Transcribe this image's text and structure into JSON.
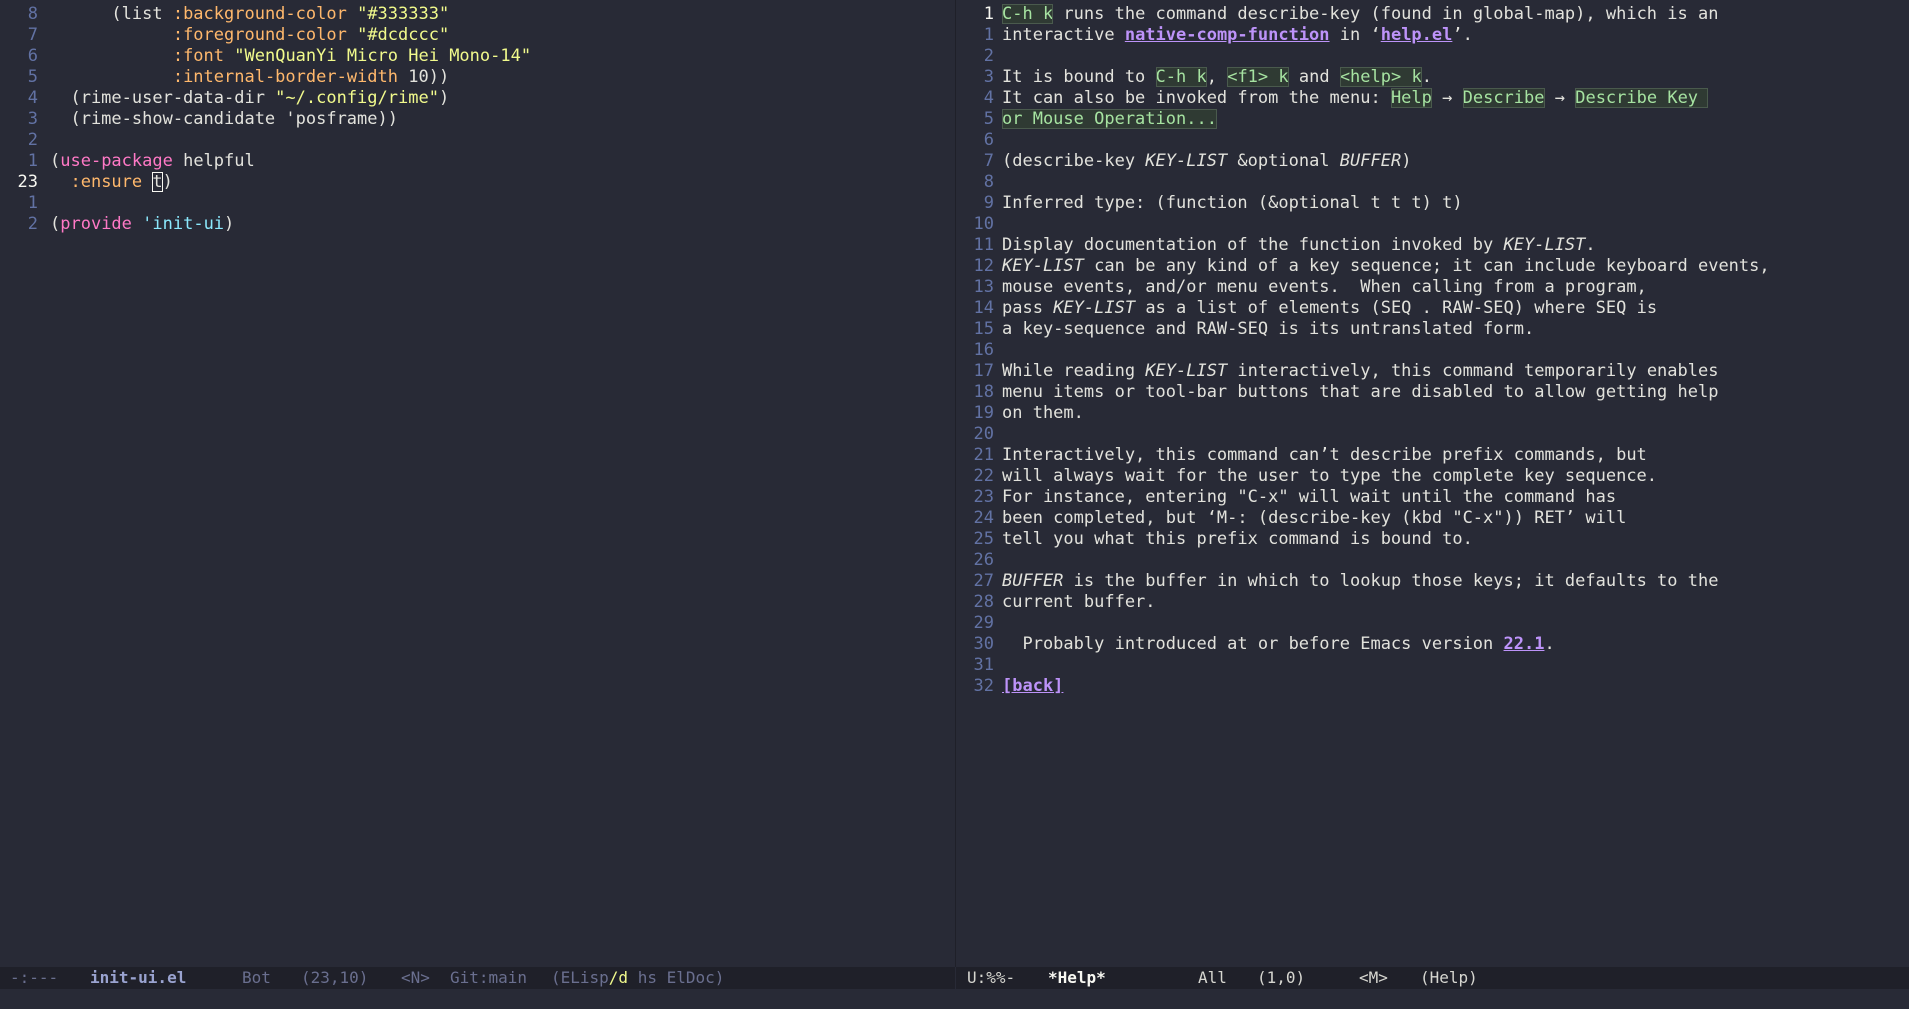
{
  "left_pane": {
    "lines": [
      {
        "num": "8",
        "parts": [
          {
            "t": "      (list ",
            "c": ""
          },
          {
            "t": ":background-color",
            "c": "kwsym"
          },
          {
            "t": " ",
            "c": ""
          },
          {
            "t": "\"#333333\"",
            "c": "str"
          }
        ]
      },
      {
        "num": "7",
        "parts": [
          {
            "t": "            ",
            "c": ""
          },
          {
            "t": ":foreground-color",
            "c": "kwsym"
          },
          {
            "t": " ",
            "c": ""
          },
          {
            "t": "\"#dcdccc\"",
            "c": "str"
          }
        ]
      },
      {
        "num": "6",
        "parts": [
          {
            "t": "            ",
            "c": ""
          },
          {
            "t": ":font",
            "c": "kwsym"
          },
          {
            "t": " ",
            "c": ""
          },
          {
            "t": "\"WenQuanYi Micro Hei Mono-14\"",
            "c": "str"
          }
        ]
      },
      {
        "num": "5",
        "parts": [
          {
            "t": "            ",
            "c": ""
          },
          {
            "t": ":internal-border-width",
            "c": "kwsym"
          },
          {
            "t": " 10))",
            "c": ""
          }
        ]
      },
      {
        "num": "4",
        "parts": [
          {
            "t": "  (rime-user-data-dir ",
            "c": ""
          },
          {
            "t": "\"~/.config/rime\"",
            "c": "str"
          },
          {
            "t": ")",
            "c": ""
          }
        ]
      },
      {
        "num": "3",
        "parts": [
          {
            "t": "  (rime-show-candidate 'posframe))",
            "c": ""
          }
        ]
      },
      {
        "num": "2",
        "parts": []
      },
      {
        "num": "1",
        "parts": [
          {
            "t": "(",
            "c": ""
          },
          {
            "t": "use-package",
            "c": "kw"
          },
          {
            "t": " helpful",
            "c": ""
          }
        ]
      },
      {
        "num": "23",
        "current": true,
        "parts": [
          {
            "t": "  ",
            "c": ""
          },
          {
            "t": ":ensure",
            "c": "kwsym"
          },
          {
            "t": " ",
            "c": ""
          },
          {
            "t": "t",
            "c": "cursor-box"
          },
          {
            "t": ")",
            "c": ""
          }
        ]
      },
      {
        "num": "1",
        "parts": []
      },
      {
        "num": "2",
        "parts": [
          {
            "t": "(",
            "c": ""
          },
          {
            "t": "provide",
            "c": "kw"
          },
          {
            "t": " ",
            "c": ""
          },
          {
            "t": "'init-ui",
            "c": "quoted"
          },
          {
            "t": ")",
            "c": ""
          }
        ]
      }
    ]
  },
  "right_pane": {
    "lines": [
      {
        "num": "1",
        "current": true,
        "parts": [
          {
            "t": "C-h k",
            "c": "key"
          },
          {
            "t": " runs the command describe-key (found in global-map), which is an",
            "c": ""
          }
        ]
      },
      {
        "num": "1",
        "parts": [
          {
            "t": "interactive ",
            "c": ""
          },
          {
            "t": "native-comp-function",
            "c": "link",
            "i": true
          },
          {
            "t": " in ‘",
            "c": ""
          },
          {
            "t": "help.el",
            "c": "link",
            "i": true
          },
          {
            "t": "’.",
            "c": ""
          }
        ]
      },
      {
        "num": "2",
        "parts": []
      },
      {
        "num": "3",
        "parts": [
          {
            "t": "It is bound to ",
            "c": ""
          },
          {
            "t": "C-h k",
            "c": "key"
          },
          {
            "t": ", ",
            "c": ""
          },
          {
            "t": "<f1> k",
            "c": "key"
          },
          {
            "t": " and ",
            "c": ""
          },
          {
            "t": "<help> k",
            "c": "key"
          },
          {
            "t": ".",
            "c": ""
          }
        ]
      },
      {
        "num": "4",
        "parts": [
          {
            "t": "It can also be invoked from the menu: ",
            "c": ""
          },
          {
            "t": "Help",
            "c": "menu",
            "i": true
          },
          {
            "t": " → ",
            "c": ""
          },
          {
            "t": "Describe",
            "c": "menu",
            "i": true
          },
          {
            "t": " → ",
            "c": ""
          },
          {
            "t": "Describe Key ",
            "c": "menu",
            "i": true
          }
        ]
      },
      {
        "num": "5",
        "parts": [
          {
            "t": "or Mouse Operation...",
            "c": "menu",
            "i": true
          }
        ]
      },
      {
        "num": "6",
        "parts": []
      },
      {
        "num": "7",
        "parts": [
          {
            "t": "(describe-key ",
            "c": ""
          },
          {
            "t": "KEY-LIST",
            "c": "arg"
          },
          {
            "t": " &optional ",
            "c": ""
          },
          {
            "t": "BUFFER",
            "c": "arg"
          },
          {
            "t": ")",
            "c": ""
          }
        ]
      },
      {
        "num": "8",
        "parts": []
      },
      {
        "num": "9",
        "parts": [
          {
            "t": "Inferred type: (function (&optional t t t) t)",
            "c": ""
          }
        ]
      },
      {
        "num": "10",
        "parts": []
      },
      {
        "num": "11",
        "parts": [
          {
            "t": "Display documentation of the function invoked by ",
            "c": ""
          },
          {
            "t": "KEY-LIST",
            "c": "arg"
          },
          {
            "t": ".",
            "c": ""
          }
        ]
      },
      {
        "num": "12",
        "parts": [
          {
            "t": "KEY-LIST",
            "c": "arg"
          },
          {
            "t": " can be any kind of a key sequence; it can include keyboard events,",
            "c": ""
          }
        ]
      },
      {
        "num": "13",
        "parts": [
          {
            "t": "mouse events, and/or menu events.  When calling from a program,",
            "c": ""
          }
        ]
      },
      {
        "num": "14",
        "parts": [
          {
            "t": "pass ",
            "c": ""
          },
          {
            "t": "KEY-LIST",
            "c": "arg"
          },
          {
            "t": " as a list of elements (SEQ . RAW-SEQ) where SEQ is",
            "c": ""
          }
        ]
      },
      {
        "num": "15",
        "parts": [
          {
            "t": "a key-sequence and RAW-SEQ is its untranslated form.",
            "c": ""
          }
        ]
      },
      {
        "num": "16",
        "parts": []
      },
      {
        "num": "17",
        "parts": [
          {
            "t": "While reading ",
            "c": ""
          },
          {
            "t": "KEY-LIST",
            "c": "arg"
          },
          {
            "t": " interactively, this command temporarily enables",
            "c": ""
          }
        ]
      },
      {
        "num": "18",
        "parts": [
          {
            "t": "menu items or tool-bar buttons that are disabled to allow getting help",
            "c": ""
          }
        ]
      },
      {
        "num": "19",
        "parts": [
          {
            "t": "on them.",
            "c": ""
          }
        ]
      },
      {
        "num": "20",
        "parts": []
      },
      {
        "num": "21",
        "parts": [
          {
            "t": "Interactively, this command can’t describe prefix commands, but",
            "c": ""
          }
        ]
      },
      {
        "num": "22",
        "parts": [
          {
            "t": "will always wait for the user to type the complete key sequence.",
            "c": ""
          }
        ]
      },
      {
        "num": "23",
        "parts": [
          {
            "t": "For instance, entering \"C-x\" will wait until the command has",
            "c": ""
          }
        ]
      },
      {
        "num": "24",
        "parts": [
          {
            "t": "been completed, but ‘M-: (describe-key (kbd \"C-x\")) RET’ will",
            "c": ""
          }
        ]
      },
      {
        "num": "25",
        "parts": [
          {
            "t": "tell you what this prefix command is bound to.",
            "c": ""
          }
        ]
      },
      {
        "num": "26",
        "parts": []
      },
      {
        "num": "27",
        "parts": [
          {
            "t": "BUFFER",
            "c": "arg"
          },
          {
            "t": " is the buffer in which to lookup those keys; it defaults to the",
            "c": ""
          }
        ]
      },
      {
        "num": "28",
        "parts": [
          {
            "t": "current buffer.",
            "c": ""
          }
        ]
      },
      {
        "num": "29",
        "parts": []
      },
      {
        "num": "30",
        "parts": [
          {
            "t": "  Probably introduced at or before Emacs version ",
            "c": ""
          },
          {
            "t": "22.1",
            "c": "link",
            "i": true
          },
          {
            "t": ".",
            "c": ""
          }
        ]
      },
      {
        "num": "31",
        "parts": []
      },
      {
        "num": "32",
        "parts": [
          {
            "t": "[back]",
            "c": "link",
            "i": true
          }
        ]
      }
    ]
  },
  "modeline_left": {
    "state": "-:---",
    "buffer": "init-ui.el",
    "position": "Bot",
    "cursor": "(23,10)",
    "evil": "<N>",
    "vc": "Git:main",
    "mode_open": "(ELisp",
    "mode_d": "/d",
    "mode_rest": " hs ElDoc)"
  },
  "modeline_right": {
    "state": "U:%%-",
    "buffer": "*Help*",
    "position": "All",
    "cursor": "(1,0)",
    "evil": "<M>",
    "mode": "(Help)"
  },
  "colors": {
    "background": "#282a36",
    "modeline_bg": "#1f2029",
    "line_number": "#6272a4",
    "keyword": "#ff79c6",
    "keyword_symbol": "#ffb86c",
    "string": "#f1fa8c",
    "link": "#bd93f9",
    "key_binding": "#a6e3a1"
  }
}
